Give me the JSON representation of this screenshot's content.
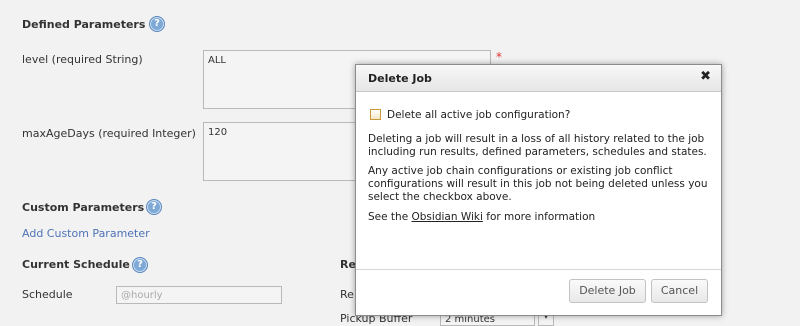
{
  "sections": {
    "defined_parameters": "Defined Parameters",
    "custom_parameters": "Custom Parameters",
    "current_schedule": "Current Schedule",
    "right_section_partial": "Re"
  },
  "fields": {
    "level_label": "level (required String)",
    "level_value": "ALL",
    "max_age_label": "maxAgeDays (required Integer)",
    "max_age_value": "120",
    "required_marker": "*",
    "add_custom_parameter": "Add Custom Parameter",
    "schedule_label": "Schedule",
    "schedule_placeholder": "@hourly",
    "right_label_partial": "Re",
    "pickup_buffer_label": "Pickup Buffer",
    "pickup_buffer_value": "2 minutes"
  },
  "help_icon_glyph": "?",
  "modal": {
    "title": "Delete Job",
    "close_glyph": "✖",
    "checkbox_label": "Delete all active job configuration?",
    "paragraph1": "Deleting a job will result in a loss of all history related to the job including run results, defined parameters, schedules and states.",
    "paragraph2": "Any active job chain configurations or existing job conflict configurations will result in this job not being deleted unless you select the checkbox above.",
    "wiki_before": "See the ",
    "wiki_link": "Obsidian Wiki",
    "wiki_after": " for more information",
    "delete_button": "Delete Job",
    "cancel_button": "Cancel"
  }
}
